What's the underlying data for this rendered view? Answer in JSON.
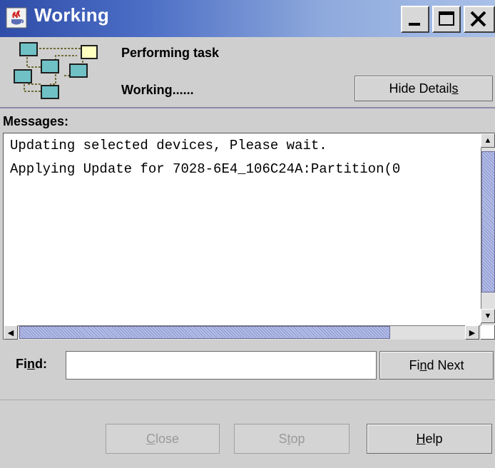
{
  "window": {
    "title": "Working",
    "controls": [
      "minimize",
      "maximize",
      "close"
    ]
  },
  "header": {
    "task_label": "Performing task",
    "status_text": "Working......",
    "hide_details_label": "Hide Details",
    "hide_details_mnemonic": "s"
  },
  "messages": {
    "label": "Messages:",
    "lines": [
      "Updating selected devices, Please wait.",
      "Applying Update for 7028-6E4_106C24A:Partition(0"
    ]
  },
  "find": {
    "label": "Find:",
    "value": "",
    "find_next_label": "Find Next"
  },
  "buttons": {
    "close": {
      "label": "Close",
      "enabled": false
    },
    "stop": {
      "label": "Stop",
      "enabled": false
    },
    "help": {
      "label": "Help",
      "enabled": true
    }
  },
  "colors": {
    "titlebar_start": "#2f4da8",
    "titlebar_end": "#a9c0e8",
    "scrollbar_thumb": "#8a96d0",
    "window_bg": "#cfcfcf"
  },
  "icons": [
    "java-app-icon",
    "network-nodes-icon",
    "scroll-up-arrow-icon",
    "scroll-down-arrow-icon",
    "scroll-left-arrow-icon",
    "scroll-right-arrow-icon"
  ]
}
